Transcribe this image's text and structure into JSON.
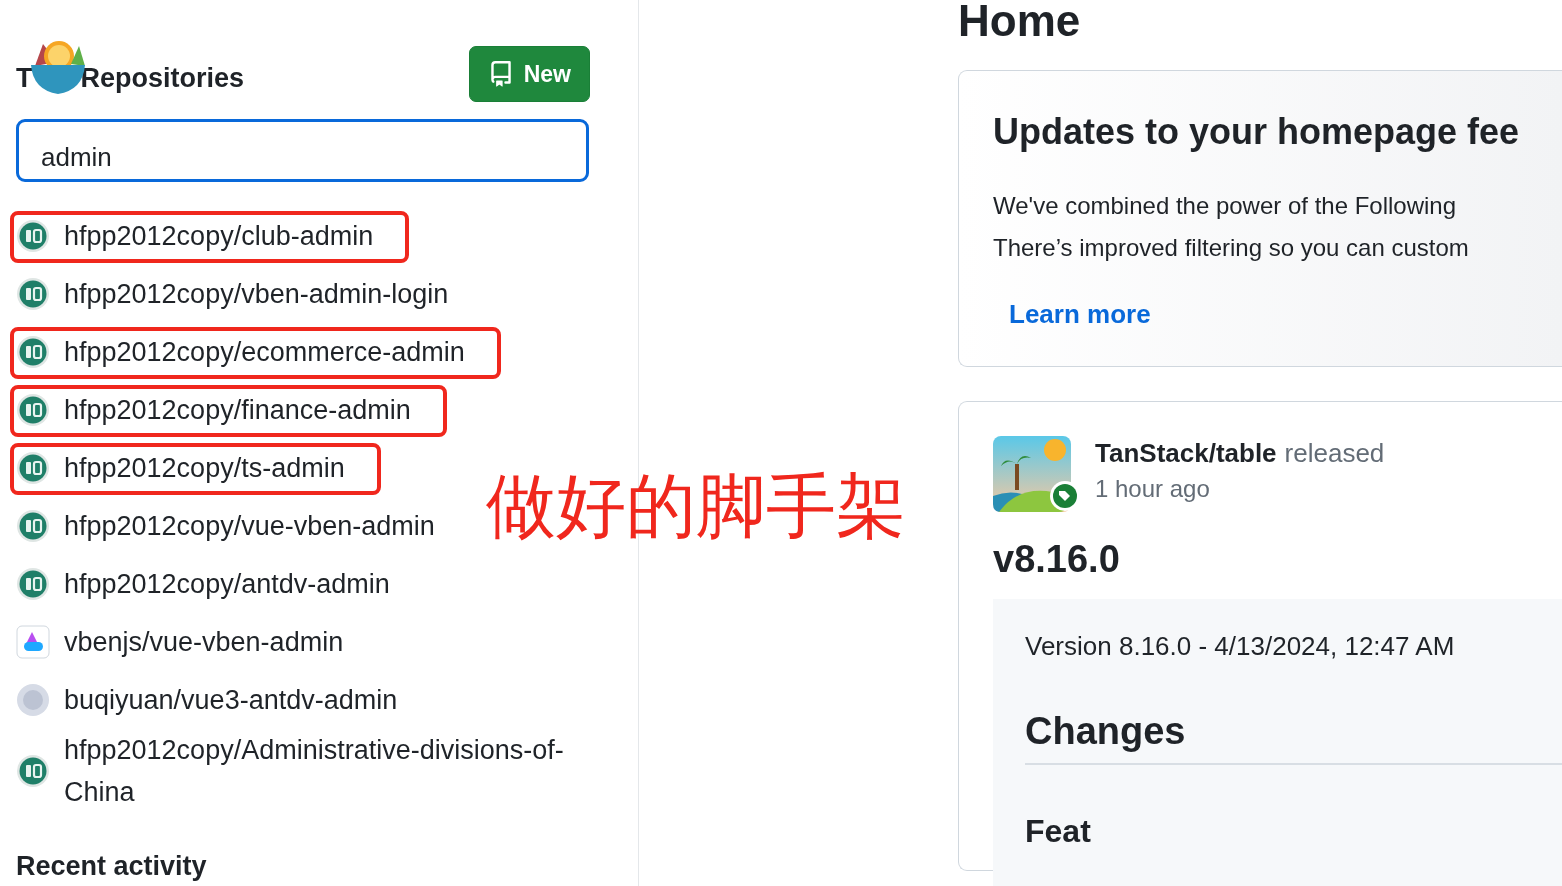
{
  "sidebar": {
    "heading_parts": [
      "T",
      "Repositories"
    ],
    "new_button": "New",
    "search": {
      "value": "admin"
    },
    "repos": [
      {
        "name": "hfpp2012copy/club-admin",
        "kind": "zhi",
        "highlighted": true
      },
      {
        "name": "hfpp2012copy/vben-admin-login",
        "kind": "zhi",
        "highlighted": false
      },
      {
        "name": "hfpp2012copy/ecommerce-admin",
        "kind": "zhi",
        "highlighted": true
      },
      {
        "name": "hfpp2012copy/finance-admin",
        "kind": "zhi",
        "highlighted": true
      },
      {
        "name": "hfpp2012copy/ts-admin",
        "kind": "zhi",
        "highlighted": true
      },
      {
        "name": "hfpp2012copy/vue-vben-admin",
        "kind": "zhi",
        "highlighted": false
      },
      {
        "name": "hfpp2012copy/antdv-admin",
        "kind": "zhi",
        "highlighted": false
      },
      {
        "name": "vbenjs/vue-vben-admin",
        "kind": "vben",
        "highlighted": false
      },
      {
        "name": "buqiyuan/vue3-antdv-admin",
        "kind": "photo",
        "highlighted": false
      },
      {
        "name": "hfpp2012copy/Administrative-divisions-of-China",
        "kind": "zhi",
        "highlighted": false
      }
    ],
    "recent_heading": "Recent activity"
  },
  "annotation": {
    "label": "做好的脚手架"
  },
  "main": {
    "title": "Home",
    "notice": {
      "title": "Updates to your homepage fee",
      "lines": [
        "We've combined the power of the Following",
        "There’s improved filtering so you can custom"
      ],
      "link": "Learn more"
    },
    "release": {
      "repo": "TanStack/table",
      "action": "released",
      "time": "1 hour ago",
      "version": "v8.16.0",
      "subtitle": "Version 8.16.0 - 4/13/2024, 12:47 AM",
      "heading": "Changes",
      "subheading": "Feat"
    }
  }
}
